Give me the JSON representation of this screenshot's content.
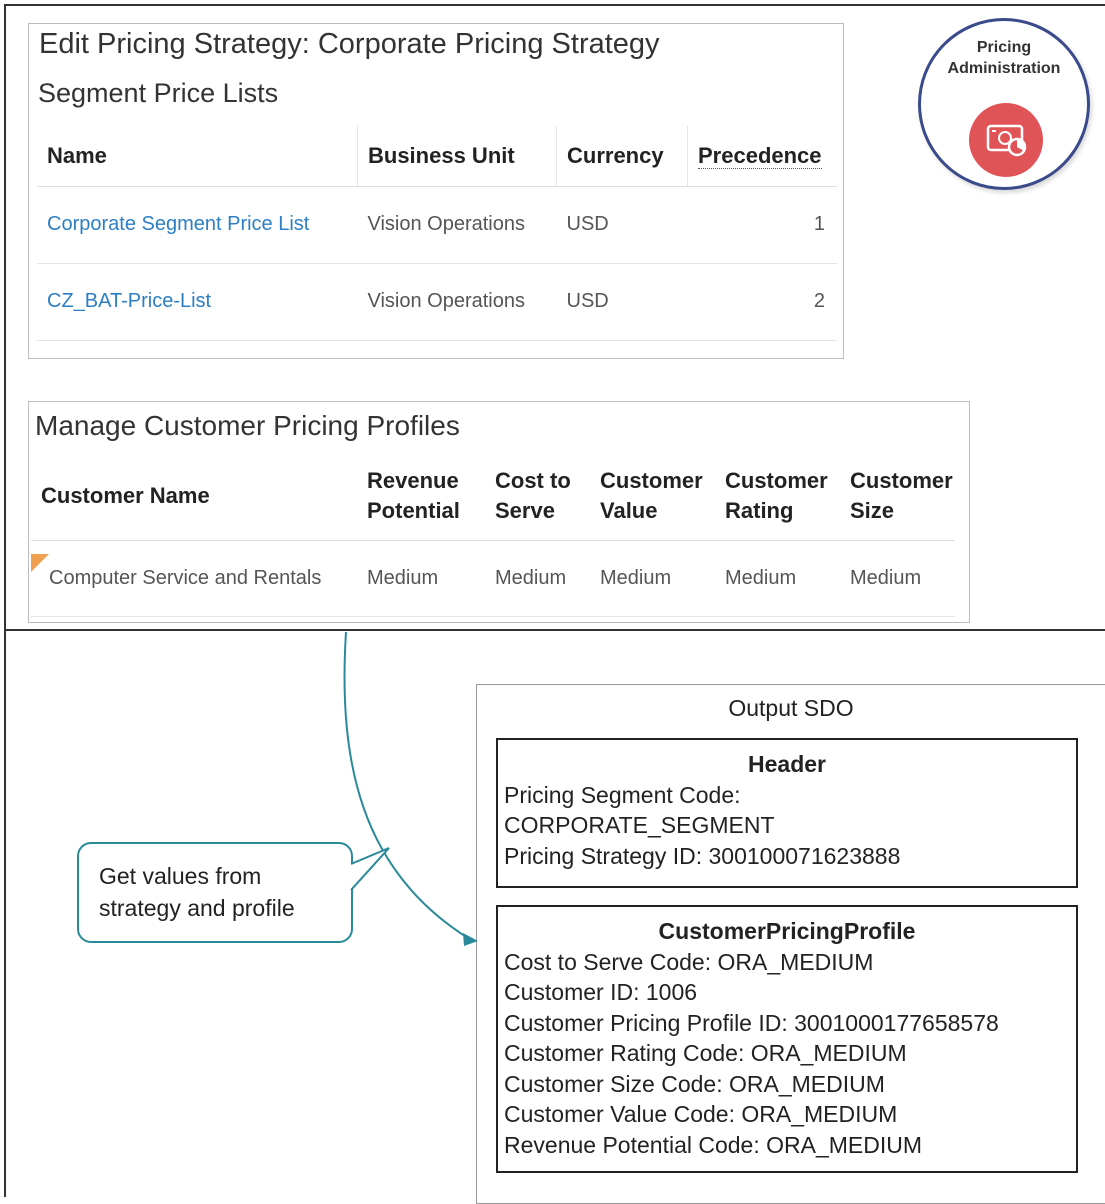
{
  "strategy_panel": {
    "title": "Edit Pricing Strategy: Corporate Pricing Strategy",
    "subtitle": "Segment Price Lists",
    "columns": [
      "Name",
      "Business Unit",
      "Currency",
      "Precedence"
    ],
    "rows": [
      {
        "name": "Corporate Segment Price List",
        "business_unit": "Vision Operations",
        "currency": "USD",
        "precedence": "1"
      },
      {
        "name": "CZ_BAT-Price-List",
        "business_unit": "Vision Operations",
        "currency": "USD",
        "precedence": "2"
      }
    ]
  },
  "profiles_panel": {
    "title": "Manage Customer Pricing Profiles",
    "columns": {
      "customer_name": "Customer Name",
      "revenue_1": "Revenue",
      "revenue_2": "Potential",
      "cost_1": "Cost to",
      "cost_2": "Serve",
      "value_1": "Customer",
      "value_2": "Value",
      "rating_1": "Customer",
      "rating_2": "Rating",
      "size_1": "Customer",
      "size_2": "Size"
    },
    "row": {
      "customer_name": "Computer Service and Rentals",
      "revenue_potential": "Medium",
      "cost_to_serve": "Medium",
      "customer_value": "Medium",
      "customer_rating": "Medium",
      "customer_size": "Medium"
    }
  },
  "badge": {
    "line1": "Pricing",
    "line2": "Administration",
    "icon": "pricing-admin-icon",
    "icon_color": "#e05457",
    "ring_color": "#3a4a8a"
  },
  "callout": {
    "line1": "Get values  from",
    "line2": "strategy and profile",
    "border_color": "#2a8a9a"
  },
  "output_sdo": {
    "title": "Output SDO",
    "header": {
      "title": "Header",
      "lines": [
        "Pricing Segment Code:",
        "CORPORATE_SEGMENT",
        "Pricing Strategy ID: 300100071623888"
      ]
    },
    "profile": {
      "title": "CustomerPricingProfile",
      "lines": [
        "Cost to Serve  Code: ORA_MEDIUM",
        "Customer ID: 1006",
        "Customer Pricing Profile ID: 3001000177658578",
        "Customer Rating Code: ORA_MEDIUM",
        "Customer  Size Code: ORA_MEDIUM",
        "Customer  Value Code: ORA_MEDIUM",
        "Revenue  Potential Code: ORA_MEDIUM"
      ]
    }
  }
}
